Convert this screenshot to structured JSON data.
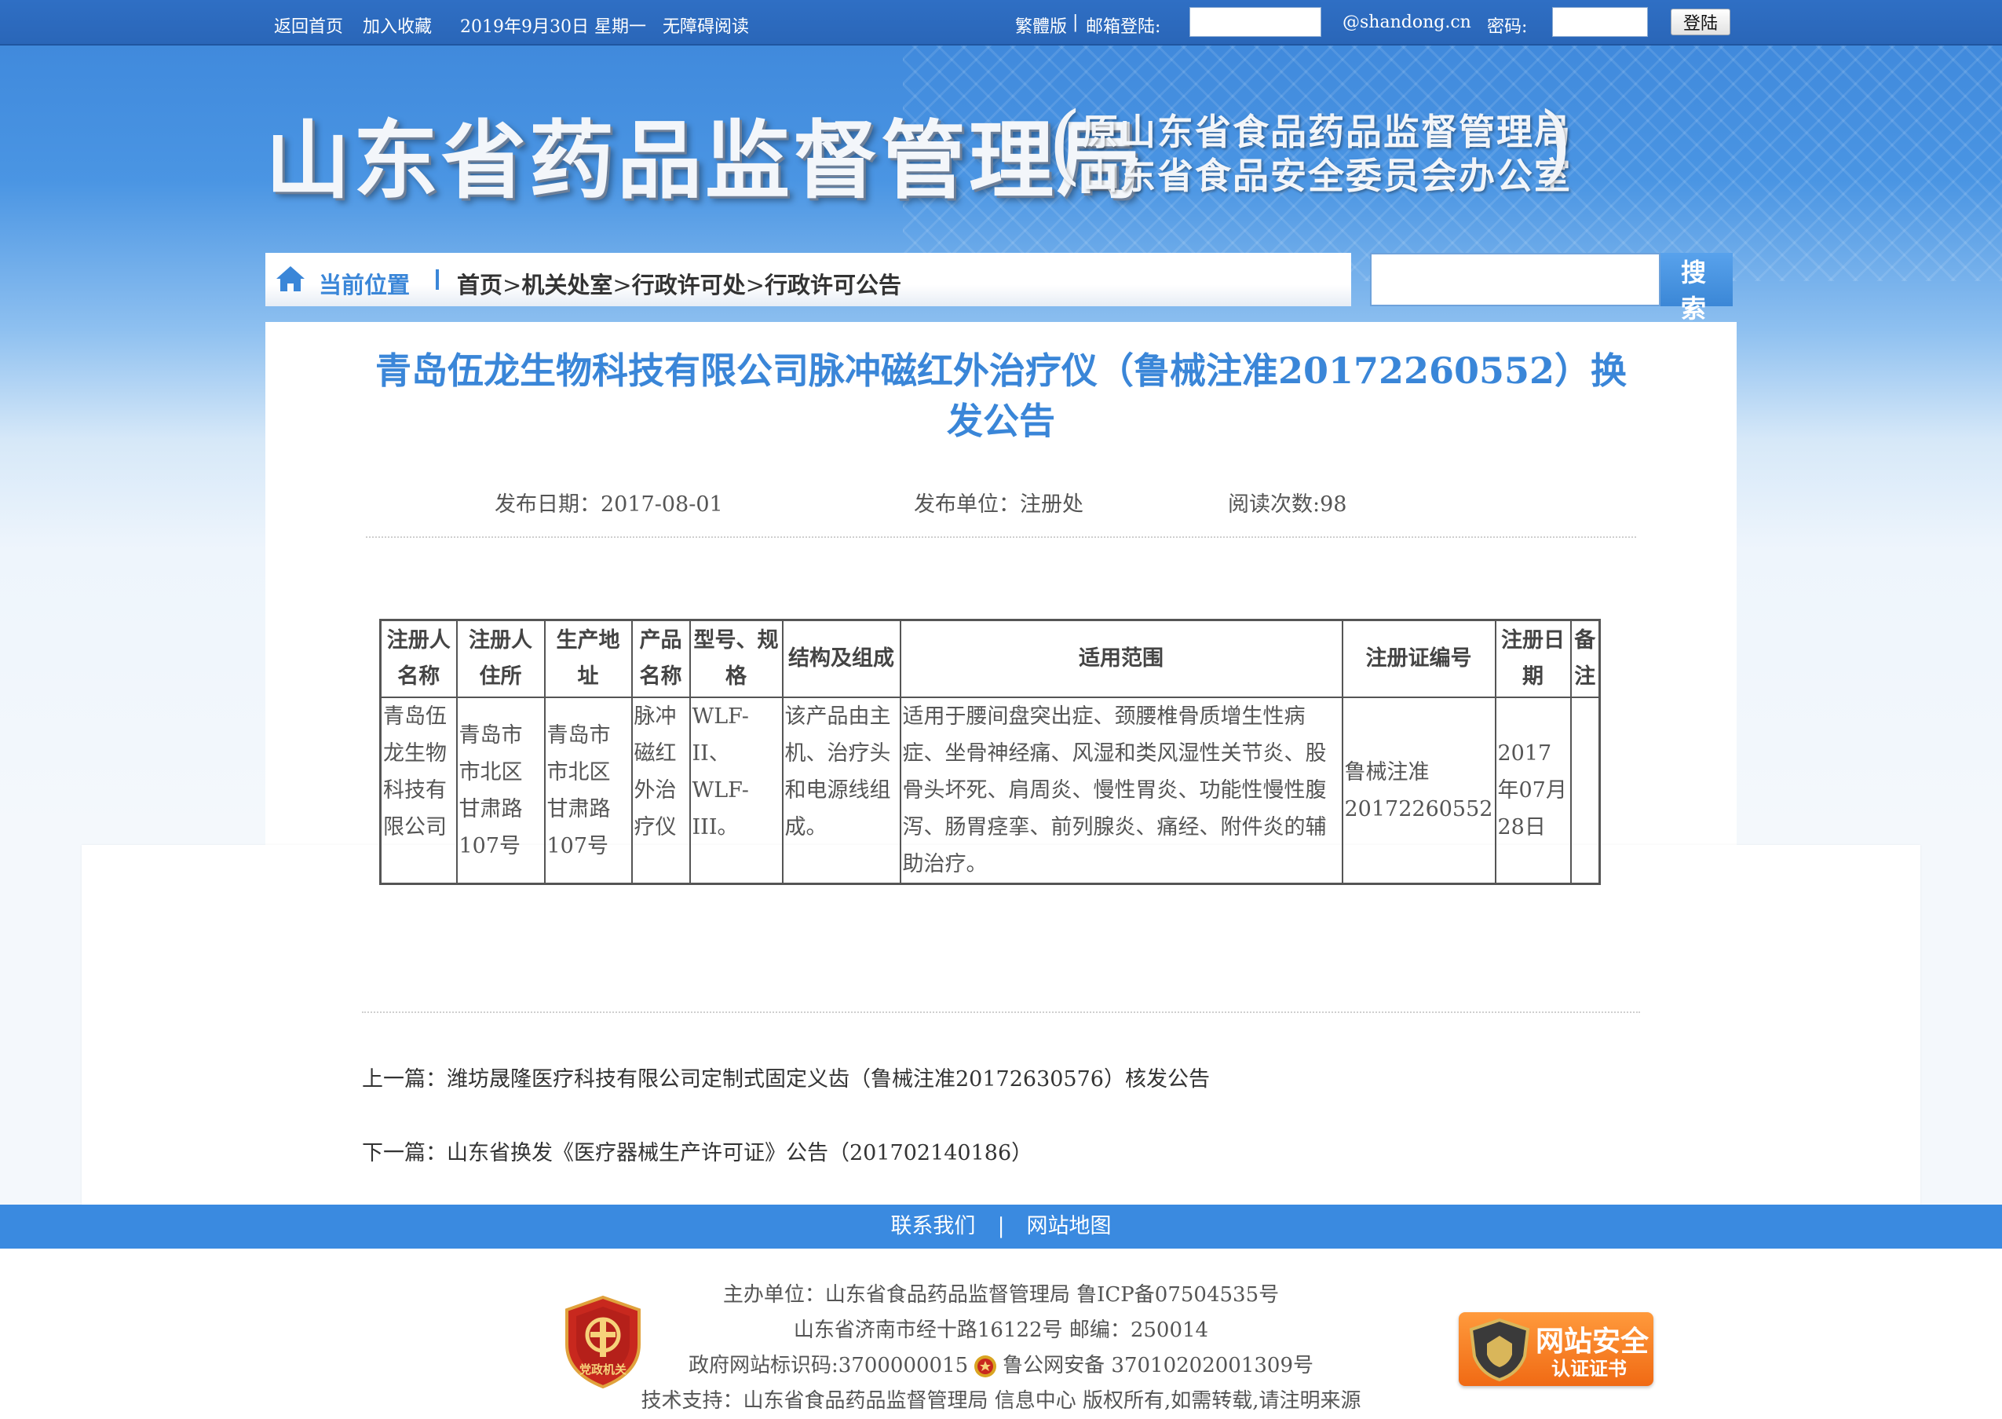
{
  "topbar": {
    "home": "返回首页",
    "favorite": "加入收藏",
    "date": "2019年9月30日 星期一",
    "accessible": "无障碍阅读",
    "traditional": "繁體版",
    "separator": "|",
    "mail_login": "邮箱登陆:",
    "mail_domain": "@shandong.cn",
    "password_label": "密码:",
    "login_button": "登陆"
  },
  "header": {
    "site_title": "山东省药品监督管理局",
    "sub_line1": "原山东省食品药品监督管理局",
    "sub_line2": "山东省食品安全委员会办公室",
    "bracket_open": "(",
    "bracket_close": ")"
  },
  "breadcrumb": {
    "label": "当前位置",
    "items": [
      "首页",
      "机关处室",
      "行政许可处",
      "行政许可公告"
    ],
    "sep": ">"
  },
  "search": {
    "button": "搜 索"
  },
  "article": {
    "title": "青岛伍龙生物科技有限公司脉冲磁红外治疗仪（鲁械注准20172260552）换发公告",
    "publish_date": "发布日期：2017-08-01",
    "publisher": "发布单位：注册处",
    "views": "阅读次数:98"
  },
  "table": {
    "headers": [
      "注册人名称",
      "注册人住所",
      "生产地址",
      "产品名称",
      "型号、规格",
      "结构及组成",
      "适用范围",
      "注册证编号",
      "注册日期",
      "备注"
    ],
    "row": [
      "青岛伍龙生物科技有限公司",
      "青岛市市北区甘肃路107号",
      "青岛市市北区甘肃路107号",
      "脉冲磁红外治疗仪",
      "WLF-II、WLF-III。",
      "该产品由主机、治疗头和电源线组成。",
      "适用于腰间盘突出症、颈腰椎骨质增生性病症、坐骨神经痛、风湿和类风湿性关节炎、股骨头坏死、肩周炎、慢性胃炎、功能性慢性腹泻、肠胃痉挛、前列腺炎、痛经、附件炎的辅助治疗。",
      "鲁械注准20172260552",
      "2017年07月28日",
      ""
    ]
  },
  "nav": {
    "prev_label": "上一篇：",
    "prev_title": "潍坊晟隆医疗科技有限公司定制式固定义齿（鲁械注准20172630576）核发公告",
    "next_label": "下一篇：",
    "next_title": "山东省换发《医疗器械生产许可证》公告（201702140186）"
  },
  "footer": {
    "contact": "联系我们",
    "bar": "|",
    "sitemap": "网站地图",
    "sponsor": "主办单位：山东省食品药品监督管理局 鲁ICP备07504535号",
    "address": "山东省济南市经十路16122号 邮编：250014",
    "gov_id": "政府网站标识码:3700000015",
    "police": "鲁公网安备 37010202001309号",
    "support": "技术支持：山东省食品药品监督管理局 信息中心 版权所有,如需转载,请注明来源",
    "badge_left_text": "党政机关",
    "badge_right_line1": "网站安全",
    "badge_right_line2": "认证证书"
  },
  "colors": {
    "accent": "#3a86d8",
    "topbar": "#2f6fc4",
    "footer_bar": "#3a8ae0",
    "badge_orange": "#f06a14",
    "badge_red": "#c8281e"
  }
}
